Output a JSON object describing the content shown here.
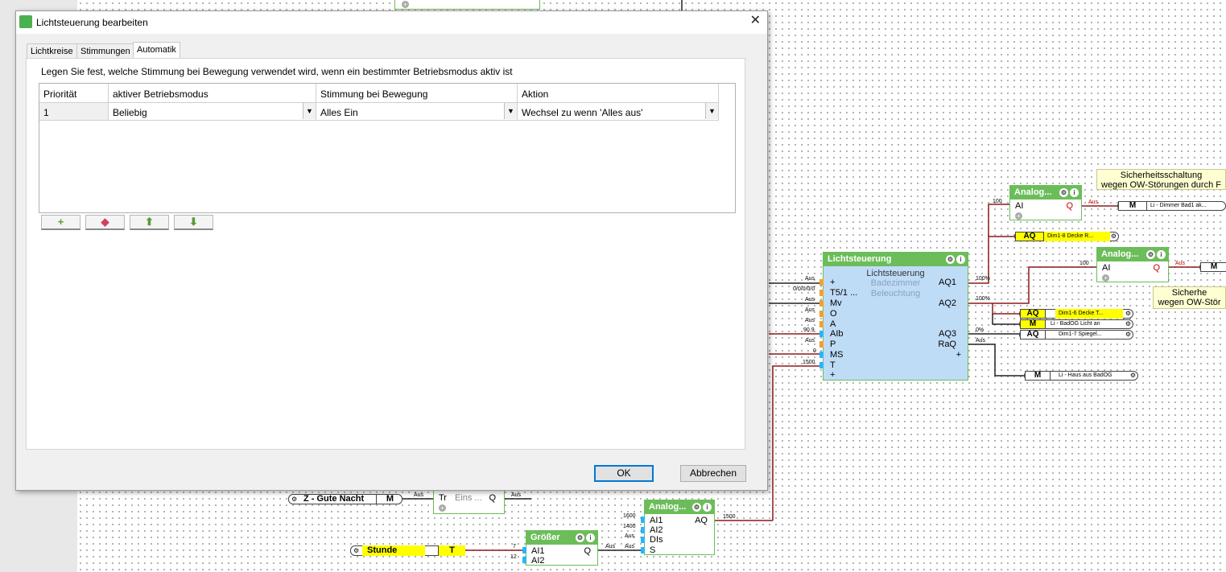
{
  "dialog": {
    "title": "Lichtsteuerung bearbeiten",
    "tabs": [
      "Lichtkreise",
      "Stimmungen",
      "Automatik"
    ],
    "active_tab": "Automatik",
    "description": "Legen Sie fest, welche Stimmung bei Bewegung verwendet wird, wenn ein bestimmter Betriebsmodus aktiv ist",
    "columns": [
      "Priorität",
      "aktiver Betriebsmodus",
      "Stimmung bei Bewegung",
      "Aktion"
    ],
    "rows": [
      {
        "prio": "1",
        "mode": "Beliebig",
        "mood": "Alles Ein",
        "action": "Wechsel zu wenn 'Alles aus'"
      }
    ],
    "toolbar": {
      "add": "+",
      "erase": "eraser-icon",
      "up": "arrow-up-icon",
      "down": "arrow-down-icon"
    },
    "ok_label": "OK",
    "cancel_label": "Abbrechen"
  },
  "canvas": {
    "main_block": {
      "title": "Lichtsteuerung",
      "subtitle1": "Lichtsteuerung",
      "subtitle2": "Badezimmer",
      "subtitle3": "Beleuchtung",
      "inputs": [
        "+",
        "T5/1 ...",
        "Mv",
        "O",
        "A",
        "AIb",
        "P",
        "MS",
        "T",
        "+"
      ],
      "input_values": [
        "Aus",
        "0/0/0/0/0",
        "Aus",
        "Aus",
        "Aus",
        "90.9",
        "Aus",
        "0",
        "1500"
      ],
      "outputs": [
        "AQ1",
        "AQ2",
        "AQ3",
        "RaQ",
        "+"
      ],
      "output_values": [
        "100%",
        "100%",
        "0%",
        "Aus"
      ]
    },
    "analog1": {
      "title": "Analog...",
      "in": "AI",
      "out": "Q",
      "in_val": "100",
      "out_val": "Aus"
    },
    "analog2": {
      "title": "Analog...",
      "in": "AI",
      "out": "Q",
      "in_val": "100",
      "out_val": "Aus"
    },
    "analog3": {
      "title": "Analog...",
      "inputs": [
        "AI1",
        "AI2",
        "DIs",
        "S"
      ],
      "out": "AQ",
      "in_vals": [
        "1600",
        "1400",
        "Aus",
        "Aus"
      ],
      "out_val": "1500"
    },
    "groesser": {
      "title": "Größer",
      "inputs": [
        "AI1",
        "AI2"
      ],
      "out": "Q",
      "in_vals": [
        "7",
        "12"
      ],
      "out_val": "Aus"
    },
    "einschalt": {
      "label": "Tr",
      "sub": "Eins ...",
      "out": "Q",
      "in_val": "Aus",
      "out_val": "Aus"
    },
    "notes": [
      {
        "line1": "Sicherheitsschaltung",
        "line2": "wegen OW-Störungen durch F"
      },
      {
        "line1": "Sicherhe",
        "line2": "wegen OW-Stör"
      }
    ],
    "outputs": [
      {
        "tag": "M",
        "name": "Li - Dimmer Bad1 ak...",
        "val": "Aus"
      },
      {
        "tag": "AQ",
        "name": "Dim1-8 Decke R...",
        "val": "100%"
      },
      {
        "tag": "M",
        "name": "",
        "val": "Aus"
      },
      {
        "tag": "AQ",
        "name": "Dim1-6 Decke T...",
        "val": "100%"
      },
      {
        "tag": "M",
        "name": "Li - BadOG Licht an",
        "val": ""
      },
      {
        "tag": "AQ",
        "name": "Dim1-7 Spiegel...",
        "val": "0%"
      },
      {
        "tag": "M",
        "name": "Li - Haus aus BadOG",
        "val": ""
      }
    ],
    "inputs_left": [
      {
        "name": "Z - Gute Nacht",
        "tag": "M"
      },
      {
        "name": "Stunde",
        "tag": "T"
      }
    ]
  }
}
